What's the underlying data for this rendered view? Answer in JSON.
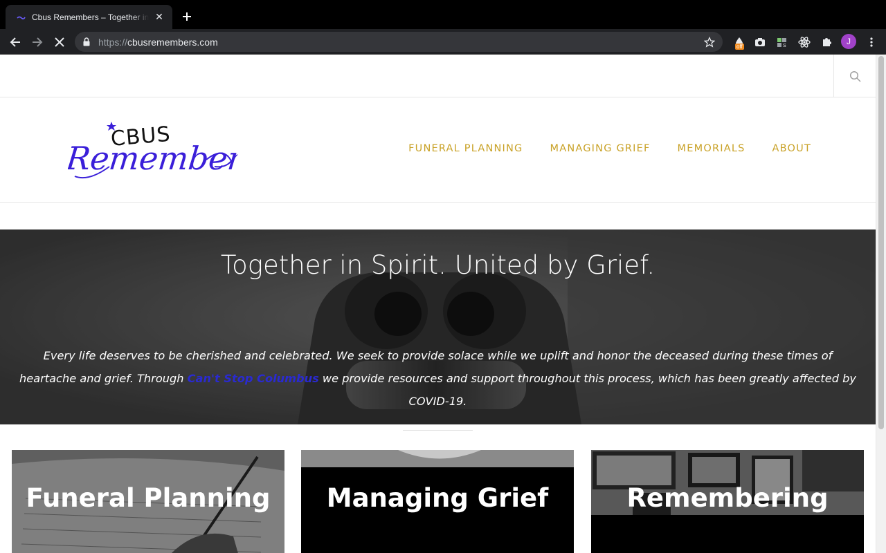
{
  "browser": {
    "tab_title": "Cbus Remembers – Together in Spirit. United by Grief.",
    "url_scheme": "https://",
    "url_host": "cbusremembers.com",
    "extension_badge": "off",
    "avatar_initial": "J"
  },
  "site": {
    "logo_text_top": "CBUS",
    "logo_text_script": "Remembers",
    "nav": [
      "FUNERAL PLANNING",
      "MANAGING GRIEF",
      "MEMORIALS",
      "ABOUT"
    ],
    "colors": {
      "nav": "#c9a227",
      "logo": "#3a1fd9",
      "link": "#2a2ad0"
    }
  },
  "hero": {
    "title": "Together in Spirit. United by Grief.",
    "body_before": "Every life deserves to be cherished and celebrated. We seek to provide solace while we uplift and honor the deceased during these times of heartache and grief. Through ",
    "link_text": "Can't Stop Columbus",
    "body_after": " we provide resources and support throughout this process, which has been greatly affected by COVID-19."
  },
  "cards": [
    {
      "title": "Funeral Planning"
    },
    {
      "title": "Managing Grief"
    },
    {
      "title": "Remembering"
    }
  ]
}
